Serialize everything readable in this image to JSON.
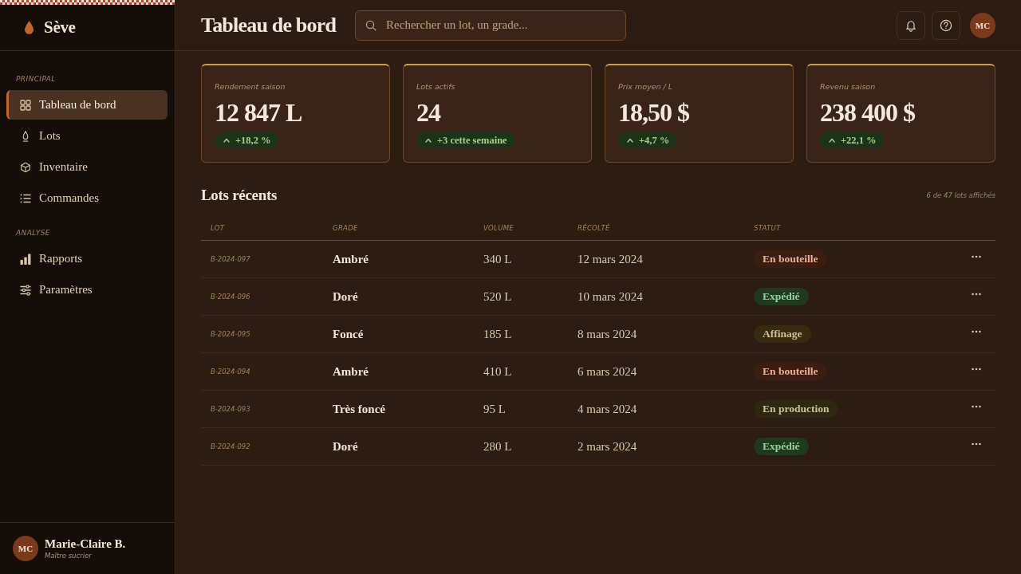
{
  "sidebar": {
    "brand": "Sève",
    "sections": [
      {
        "heading": "PRINCIPAL",
        "items": [
          {
            "label": "Tableau de bord",
            "selected": true
          },
          {
            "label": "Lots",
            "selected": false
          },
          {
            "label": "Inventaire",
            "selected": false
          },
          {
            "label": "Commandes",
            "selected": false
          }
        ]
      },
      {
        "heading": "ANALYSE",
        "items": [
          {
            "label": "Rapports",
            "selected": false
          },
          {
            "label": "Paramètres",
            "selected": false
          }
        ]
      }
    ],
    "user": {
      "initials": "MC",
      "name": "Marie-Claire B.",
      "role": "Maître sucrier"
    }
  },
  "header": {
    "title": "Tableau de bord",
    "search": {
      "placeholder": "Rechercher un lot, un grade..."
    },
    "avatar": "MC"
  },
  "stats": [
    {
      "label": "Rendement saison",
      "value": "12 847 L",
      "delta": "+18,2 %"
    },
    {
      "label": "Lots actifs",
      "value": "24",
      "delta": "+3 cette semaine"
    },
    {
      "label": "Prix moyen / L",
      "value": "18,50 $",
      "delta": "+4,7 %"
    },
    {
      "label": "Revenu saison",
      "value": "238 400 $",
      "delta": "+22,1 %"
    }
  ],
  "recent_lots": {
    "title": "Lots récents",
    "summary": "6 de 47 lots affichés",
    "columns": [
      "LOT",
      "GRADE",
      "VOLUME",
      "RÉCOLTÉ",
      "STATUT"
    ],
    "rows": [
      {
        "lot": "B-2024-097",
        "grade": "Ambré",
        "volume": "340 L",
        "harvested": "12 mars 2024",
        "status": {
          "label": "En bouteille",
          "color": "#3b1d12"
        }
      },
      {
        "lot": "B-2024-096",
        "grade": "Doré",
        "volume": "520 L",
        "harvested": "10 mars 2024",
        "status": {
          "label": "Expédié",
          "color": "#1f3a1c"
        }
      },
      {
        "lot": "B-2024-095",
        "grade": "Foncé",
        "volume": "185 L",
        "harvested": "8 mars 2024",
        "status": {
          "label": "Affinage",
          "color": "#3a2b10"
        }
      },
      {
        "lot": "B-2024-094",
        "grade": "Ambré",
        "volume": "410 L",
        "harvested": "6 mars 2024",
        "status": {
          "label": "En bouteille",
          "color": "#3b1d12"
        }
      },
      {
        "lot": "B-2024-093",
        "grade": "Très foncé",
        "volume": "95 L",
        "harvested": "4 mars 2024",
        "status": {
          "label": "En production",
          "color": "#2e2712"
        }
      },
      {
        "lot": "B-2024-092",
        "grade": "Doré",
        "volume": "280 L",
        "harvested": "2 mars 2024",
        "status": {
          "label": "Expédié",
          "color": "#1f3a1c"
        }
      }
    ]
  }
}
